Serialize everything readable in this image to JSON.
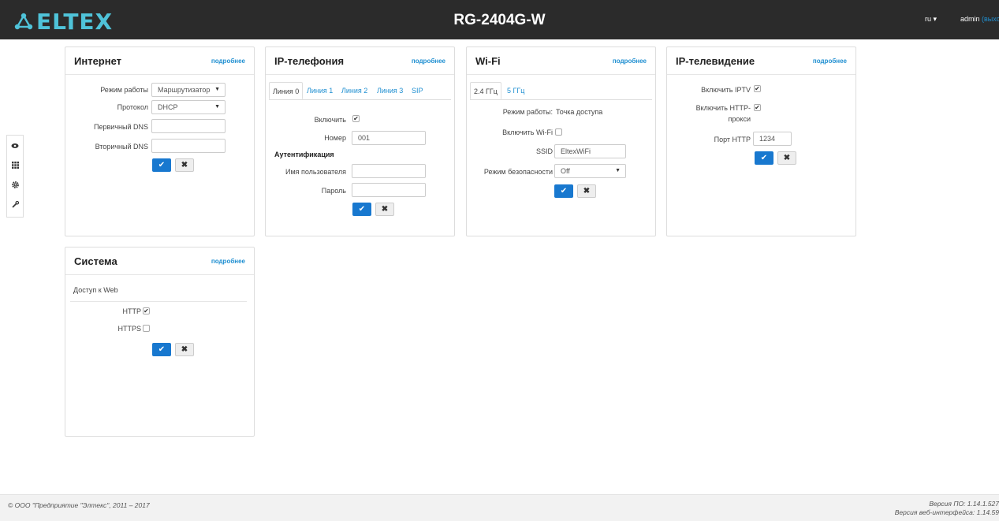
{
  "header": {
    "logo_text": "ELTEX",
    "model": "RG-2404G-W",
    "lang": "ru ▾",
    "user": "admin",
    "logout": "(выход)"
  },
  "sidenav": {
    "icons": [
      "eye-icon",
      "grid-icon",
      "gear-icon",
      "wrench-icon"
    ]
  },
  "internet": {
    "title": "Интернет",
    "more": "подробнее",
    "mode_label": "Режим работы",
    "mode_value": "Маршрутизатор",
    "protocol_label": "Протокол",
    "protocol_value": "DHCP",
    "dns1_label": "Первичный DNS",
    "dns1_value": "",
    "dns2_label": "Вторичный DNS",
    "dns2_value": ""
  },
  "telephony": {
    "title": "IP-телефония",
    "more": "подробнее",
    "tabs": [
      "Линия 0",
      "Линия 1",
      "Линия 2",
      "Линия 3",
      "SIP"
    ],
    "enable_label": "Включить",
    "enable_checked": true,
    "number_label": "Номер",
    "number_value": "001",
    "auth_heading": "Аутентификация",
    "username_label": "Имя пользователя",
    "username_value": "",
    "password_label": "Пароль",
    "password_value": ""
  },
  "wifi": {
    "title": "Wi-Fi",
    "more": "подробнее",
    "tabs": [
      "2.4 ГГц",
      "5 ГГц"
    ],
    "mode_label": "Режим работы:",
    "mode_value": "Точка доступа",
    "enable_label": "Включить Wi-Fi",
    "enable_checked": false,
    "ssid_label": "SSID",
    "ssid_value": "EltexWiFi",
    "security_label": "Режим безопасности",
    "security_value": "Off"
  },
  "iptv": {
    "title": "IP-телевидение",
    "more": "подробнее",
    "enable_label": "Включить IPTV",
    "enable_checked": true,
    "proxy_label_1": "Включить HTTP-",
    "proxy_label_2": "прокси",
    "proxy_checked": true,
    "port_label": "Порт HTTP",
    "port_value": "1234"
  },
  "system": {
    "title": "Система",
    "more": "подробнее",
    "web_access": "Доступ к Web",
    "http_label": "HTTP",
    "http_checked": true,
    "https_label": "HTTPS",
    "https_checked": false
  },
  "buttons": {
    "ok": "✔",
    "cancel": "✖"
  },
  "footer": {
    "copyright": "© ООО \"Предприятие \"Элтекс\", 2011 – 2017",
    "fw_version": "Версия ПО: 1.14.1.527",
    "web_version": "Версия веб-интерфейса: 1.14.59"
  }
}
